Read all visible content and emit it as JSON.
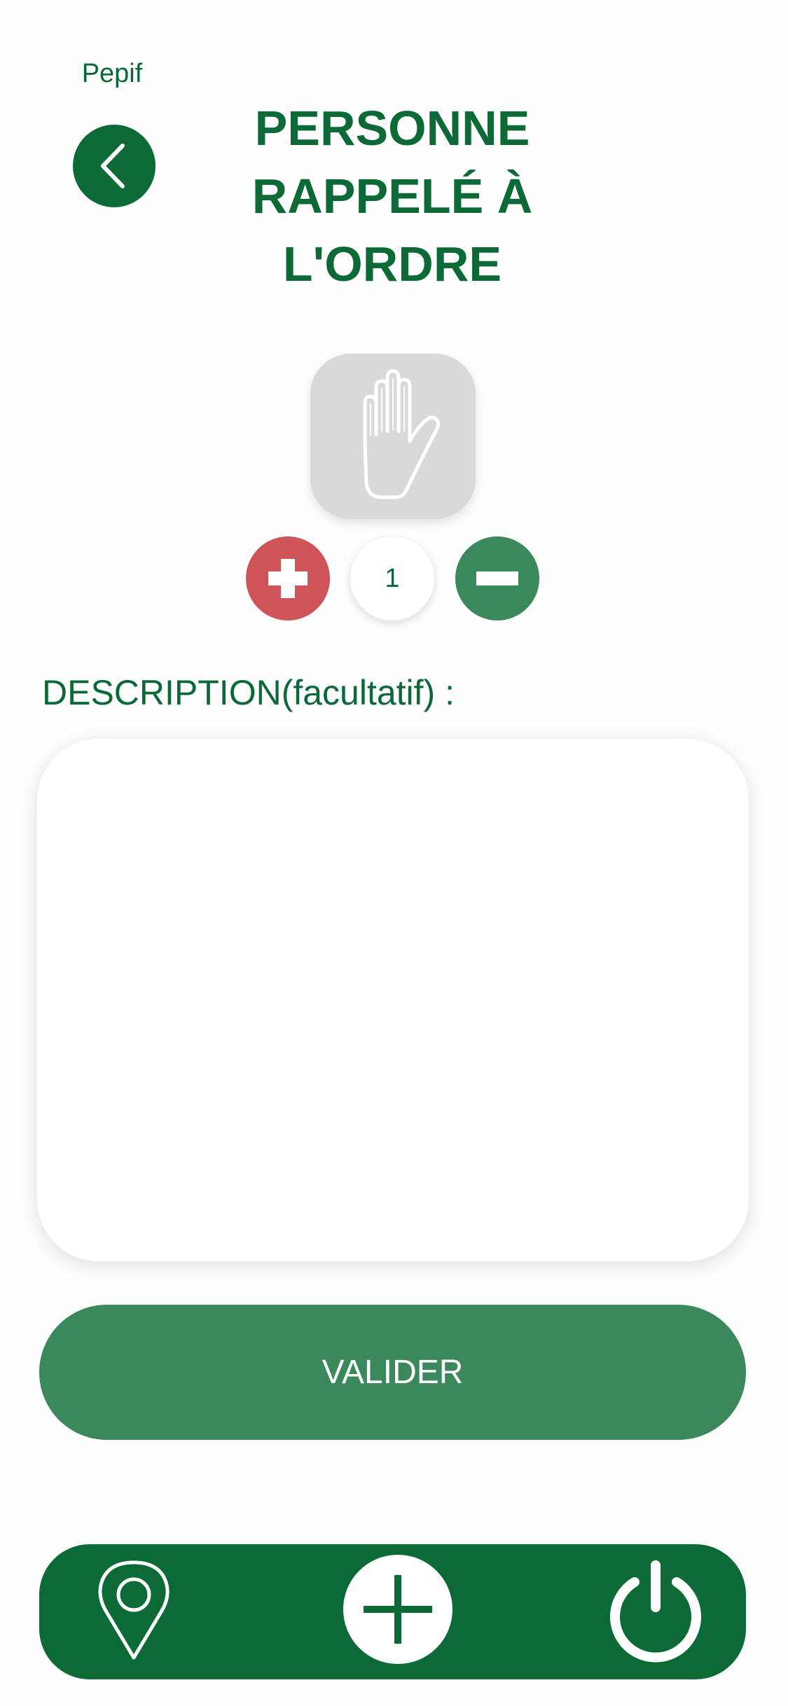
{
  "header": {
    "user_name": "Pepif",
    "title": "PERSONNE\nRAPPELÉ À\nL'ORDRE"
  },
  "incident": {
    "icon": "raised-hand-icon",
    "count": "1"
  },
  "description": {
    "label": "DESCRIPTION(facultatif) :",
    "value": "",
    "placeholder": ""
  },
  "actions": {
    "validate_label": "VALIDER"
  },
  "nav": {
    "items": [
      "location-pin-icon",
      "add-circle-icon",
      "power-icon"
    ]
  },
  "colors": {
    "primary_green": "#0b6a36",
    "button_green": "#3a885b",
    "plus_red": "#cf5457",
    "tile_gray": "#d9d9d9"
  }
}
